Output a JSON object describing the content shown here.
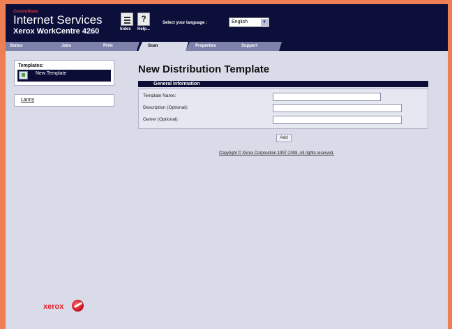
{
  "header": {
    "brand_small": "CentreWare",
    "brand_title": "Internet Services",
    "product": "Xerox WorkCentre 4260",
    "index_label": "Index",
    "help_label": "Help...",
    "help_glyph": "?",
    "language_label": "Select your language :",
    "language_value": "English",
    "dropdown_glyph": "▼"
  },
  "tabs": [
    {
      "label": "Status"
    },
    {
      "label": "Jobs"
    },
    {
      "label": "Print"
    },
    {
      "label": "Scan"
    },
    {
      "label": "Properties"
    },
    {
      "label": "Support"
    }
  ],
  "active_tab": "Scan",
  "sidebar": {
    "templates_title": "Templates:",
    "templates": [
      {
        "label": "New Template"
      }
    ],
    "user_link": "Lanny"
  },
  "main": {
    "title": "New Distribution Template",
    "section_title": "General Information",
    "fields": [
      {
        "label": "Template Name:",
        "value": ""
      },
      {
        "label": "Description (Optional):",
        "value": ""
      },
      {
        "label": "Owner (Optional):",
        "value": ""
      }
    ],
    "add_label": "Add",
    "copyright": "Copyright © Xerox Corporation 1997-2008. All rights reserved."
  },
  "footer": {
    "logo_text": "xerox"
  },
  "colors": {
    "navy": "#0c0f3a",
    "page_bg": "#d9dce8",
    "outer_bg": "#ee7e53",
    "tab_inactive": "#7d82ab",
    "logo_red": "#e3202b"
  }
}
